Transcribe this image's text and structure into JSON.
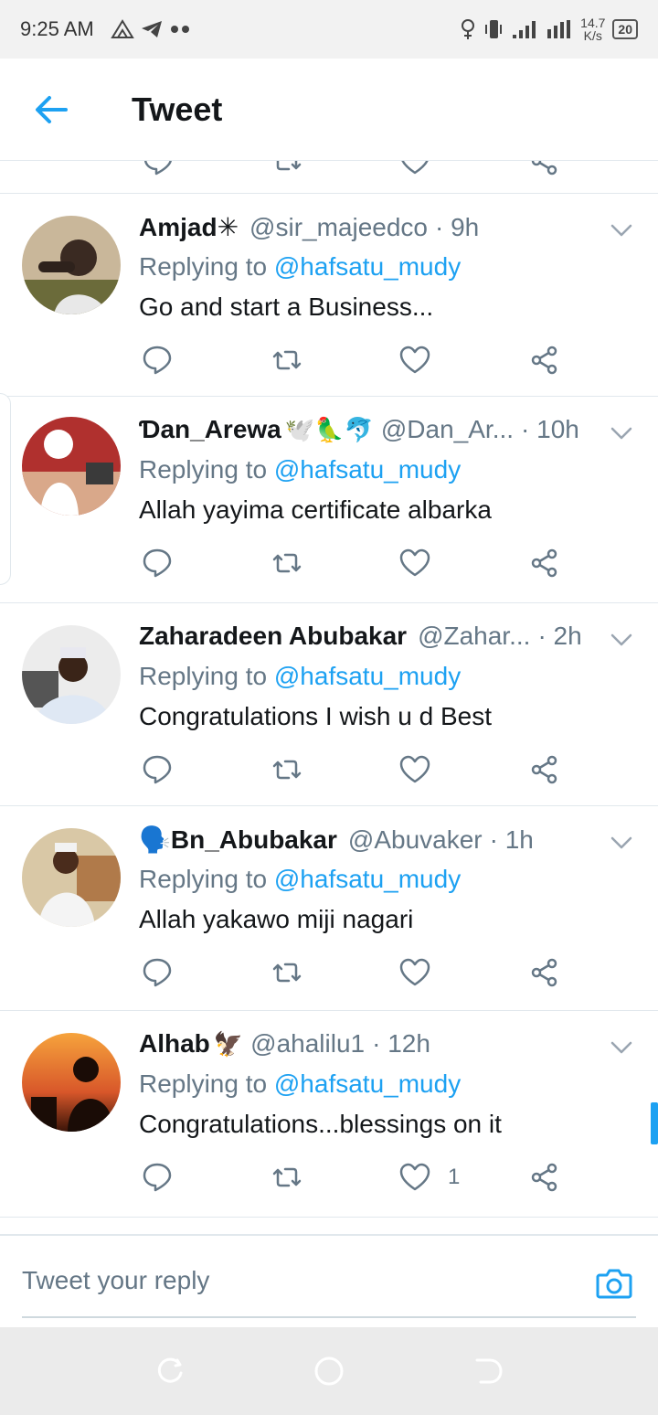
{
  "status_bar": {
    "time": "9:25 AM",
    "network_speed_value": "14.7",
    "network_speed_unit": "K/s",
    "battery": "20"
  },
  "header": {
    "title": "Tweet"
  },
  "tweets": [
    {
      "name": "Amjad✳",
      "name_emoji": "",
      "handle": "@sir_majeedco",
      "time": "· 9h",
      "replying_label": "Replying to",
      "replying_to": "@hafsatu_mudy",
      "text": "Go and start a Business...",
      "like_count": ""
    },
    {
      "name": "Ɗan_Arewa",
      "name_emoji": "🕊️🦜🐬",
      "handle": "@Dan_Ar...",
      "time": "· 10h",
      "replying_label": "Replying to",
      "replying_to": "@hafsatu_mudy",
      "text": "Allah yayima certificate albarka",
      "like_count": ""
    },
    {
      "name": "Zaharadeen Abubakar",
      "name_emoji": "",
      "handle": "@Zahar...",
      "time": "· 2h",
      "replying_label": "Replying to",
      "replying_to": "@hafsatu_mudy",
      "text": "Congratulations I wish u d Best",
      "like_count": ""
    },
    {
      "name": "🗣️Bn_Abubakar",
      "name_emoji": "",
      "handle": "@Abuvaker",
      "time": "· 1h",
      "replying_label": "Replying to",
      "replying_to": "@hafsatu_mudy",
      "text": "Allah yakawo miji nagari",
      "like_count": ""
    },
    {
      "name": "Alhab",
      "name_emoji": "🦅",
      "handle": "@ahalilu1",
      "time": "· 12h",
      "replying_label": "Replying to",
      "replying_to": "@hafsatu_mudy",
      "text": "Congratulations...blessings on it",
      "like_count": "1"
    }
  ],
  "compose": {
    "placeholder": "Tweet your reply"
  },
  "colors": {
    "accent": "#1da1f2",
    "secondary_text": "#657786",
    "divider": "#e1e8ed"
  },
  "icons": {
    "back": "arrow-left-icon",
    "reply": "reply-icon",
    "retweet": "retweet-icon",
    "like": "heart-icon",
    "share": "share-icon",
    "caret": "chevron-down-icon",
    "camera": "camera-icon"
  }
}
